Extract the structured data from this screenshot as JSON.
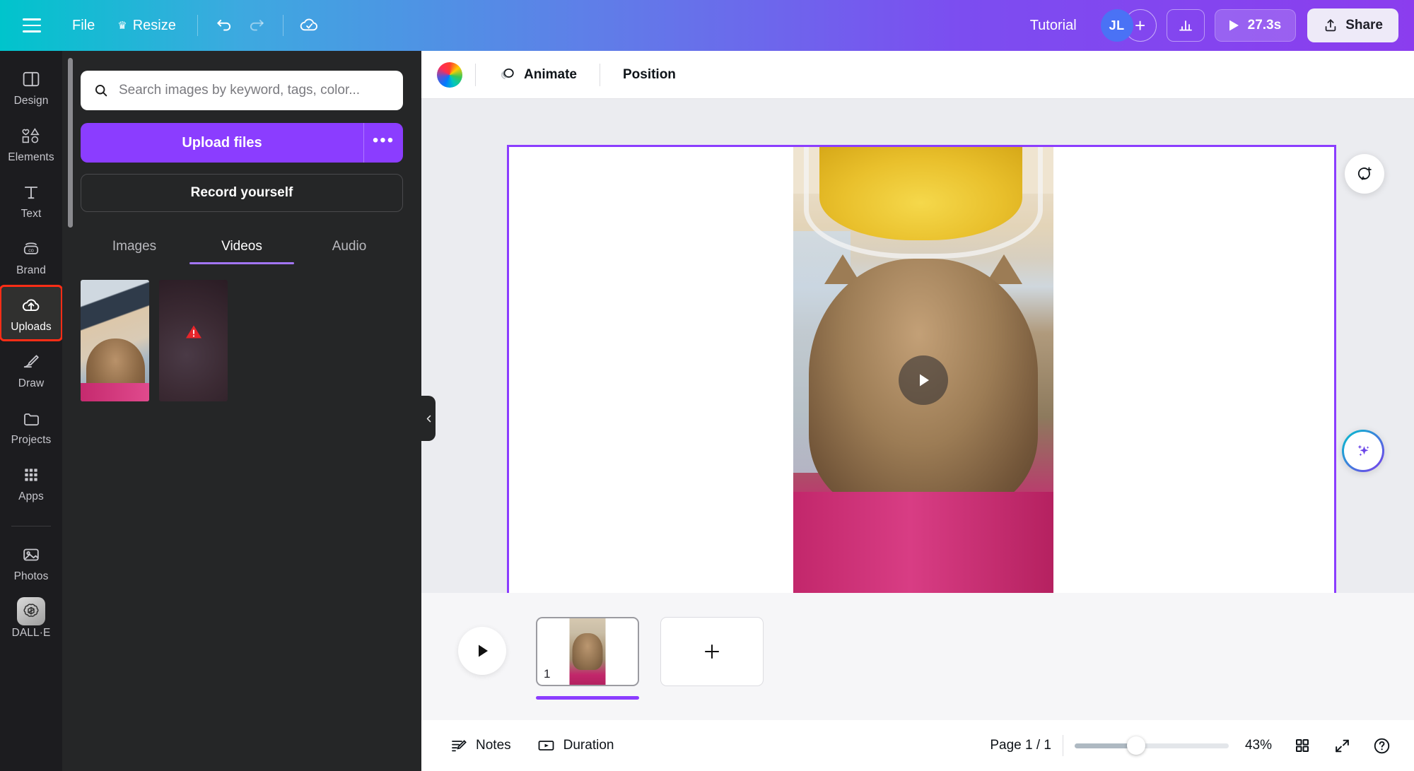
{
  "topbar": {
    "menu_icon": "hamburger-icon",
    "file_label": "File",
    "resize_label": "Resize",
    "resize_badge_icon": "crown-icon",
    "undo_icon": "undo-icon",
    "redo_icon": "redo-icon",
    "saved_icon": "cloud-check-icon",
    "tutorial_label": "Tutorial",
    "avatar_initials": "JL",
    "add_member_icon": "plus-icon",
    "insights_icon": "bar-chart-icon",
    "play_icon": "play-icon",
    "duration_label": "27.3s",
    "share_icon": "share-upload-icon",
    "share_label": "Share"
  },
  "sidebar": {
    "items": [
      {
        "label": "Design",
        "icon": "layout-icon",
        "active": false
      },
      {
        "label": "Elements",
        "icon": "shapes-icon",
        "active": false
      },
      {
        "label": "Text",
        "icon": "text-t-icon",
        "active": false
      },
      {
        "label": "Brand",
        "icon": "brand-co-icon",
        "active": false
      },
      {
        "label": "Uploads",
        "icon": "cloud-upload-icon",
        "active": true
      },
      {
        "label": "Draw",
        "icon": "pen-icon",
        "active": false
      },
      {
        "label": "Projects",
        "icon": "folder-icon",
        "active": false
      },
      {
        "label": "Apps",
        "icon": "grid-dots-icon",
        "active": false
      }
    ],
    "bottom_items": [
      {
        "label": "Photos",
        "icon": "photo-icon"
      },
      {
        "label": "DALL·E",
        "icon": "openai-icon"
      }
    ],
    "highlight_color": "#ff2d16"
  },
  "panel": {
    "search": {
      "placeholder": "Search images by keyword, tags, color...",
      "value": "",
      "icon": "search-icon"
    },
    "upload_label": "Upload files",
    "upload_more_icon": "ellipsis-icon",
    "record_label": "Record yourself",
    "tabs": [
      {
        "label": "Images",
        "active": false
      },
      {
        "label": "Videos",
        "active": true
      },
      {
        "label": "Audio",
        "active": false
      }
    ],
    "accent_color": "#8b3dff",
    "tab_underline_color": "#a375f7",
    "thumbnails": [
      {
        "name": "cat-video-thumbnail",
        "badge": null
      },
      {
        "name": "dark-video-thumbnail",
        "badge": "warning-icon"
      }
    ],
    "collapse_icon": "chevron-left-icon"
  },
  "canvas_toolbar": {
    "color_icon": "color-wheel-icon",
    "animate_icon": "animate-icon",
    "animate_label": "Animate",
    "position_label": "Position"
  },
  "canvas": {
    "play_icon": "play-icon",
    "comment_icon": "add-comment-icon",
    "magic_icon": "magic-sparkles-icon",
    "collapse_icon": "chevron-down-icon",
    "selection_color": "#8b3dff"
  },
  "page_strip": {
    "play_icon": "play-icon",
    "page_number": "1",
    "add_page_icon": "plus-icon",
    "progress_color": "#8b3dff"
  },
  "bottombar": {
    "notes_icon": "notes-pencil-icon",
    "notes_label": "Notes",
    "duration_icon": "duration-icon",
    "duration_label": "Duration",
    "page_indicator": "Page 1 / 1",
    "zoom_value": "43%",
    "grid_icon": "grid-view-icon",
    "expand_icon": "fullscreen-icon",
    "help_icon": "help-icon"
  }
}
